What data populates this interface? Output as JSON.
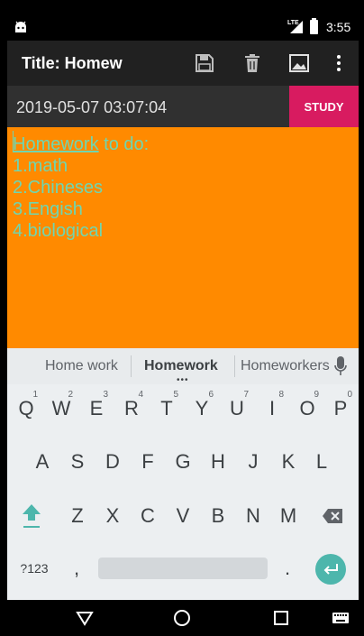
{
  "status_bar": {
    "network_label": "LTE",
    "time": "3:55"
  },
  "app_bar": {
    "title": "Title: Homew",
    "icons": [
      "save-icon",
      "delete-icon",
      "image-icon",
      "overflow-menu-icon"
    ]
  },
  "date_bar": {
    "timestamp": "2019-05-07 03:07:04",
    "study_button": "STUDY"
  },
  "note": {
    "line1_underlined": "Homework",
    "line1_rest": " to do:",
    "line2": "1.math",
    "line3": "2.Chineses",
    "line4": "3.Engish",
    "line5": "4.biological"
  },
  "colors": {
    "note_background": "#ff8a00",
    "note_text": "#6fd6b0",
    "study_button": "#d81b60",
    "app_bar": "#212121",
    "enter_key": "#4db6ac"
  },
  "keyboard": {
    "suggestions": [
      "Home work",
      "Homework",
      "Homeworkers"
    ],
    "row1": [
      {
        "label": "Q",
        "hint": "1"
      },
      {
        "label": "W",
        "hint": "2"
      },
      {
        "label": "E",
        "hint": "3"
      },
      {
        "label": "R",
        "hint": "4"
      },
      {
        "label": "T",
        "hint": "5"
      },
      {
        "label": "Y",
        "hint": "6"
      },
      {
        "label": "U",
        "hint": "7"
      },
      {
        "label": "I",
        "hint": "8"
      },
      {
        "label": "O",
        "hint": "9"
      },
      {
        "label": "P",
        "hint": "0"
      }
    ],
    "row2": [
      "A",
      "S",
      "D",
      "F",
      "G",
      "H",
      "J",
      "K",
      "L"
    ],
    "row3": [
      "Z",
      "X",
      "C",
      "V",
      "B",
      "N",
      "M"
    ],
    "symbols_key": "?123",
    "comma_key": ",",
    "period_key": "."
  },
  "nav_bar": {
    "icons": [
      "back-icon",
      "home-icon",
      "recents-icon",
      "keyboard-switch-icon"
    ]
  }
}
